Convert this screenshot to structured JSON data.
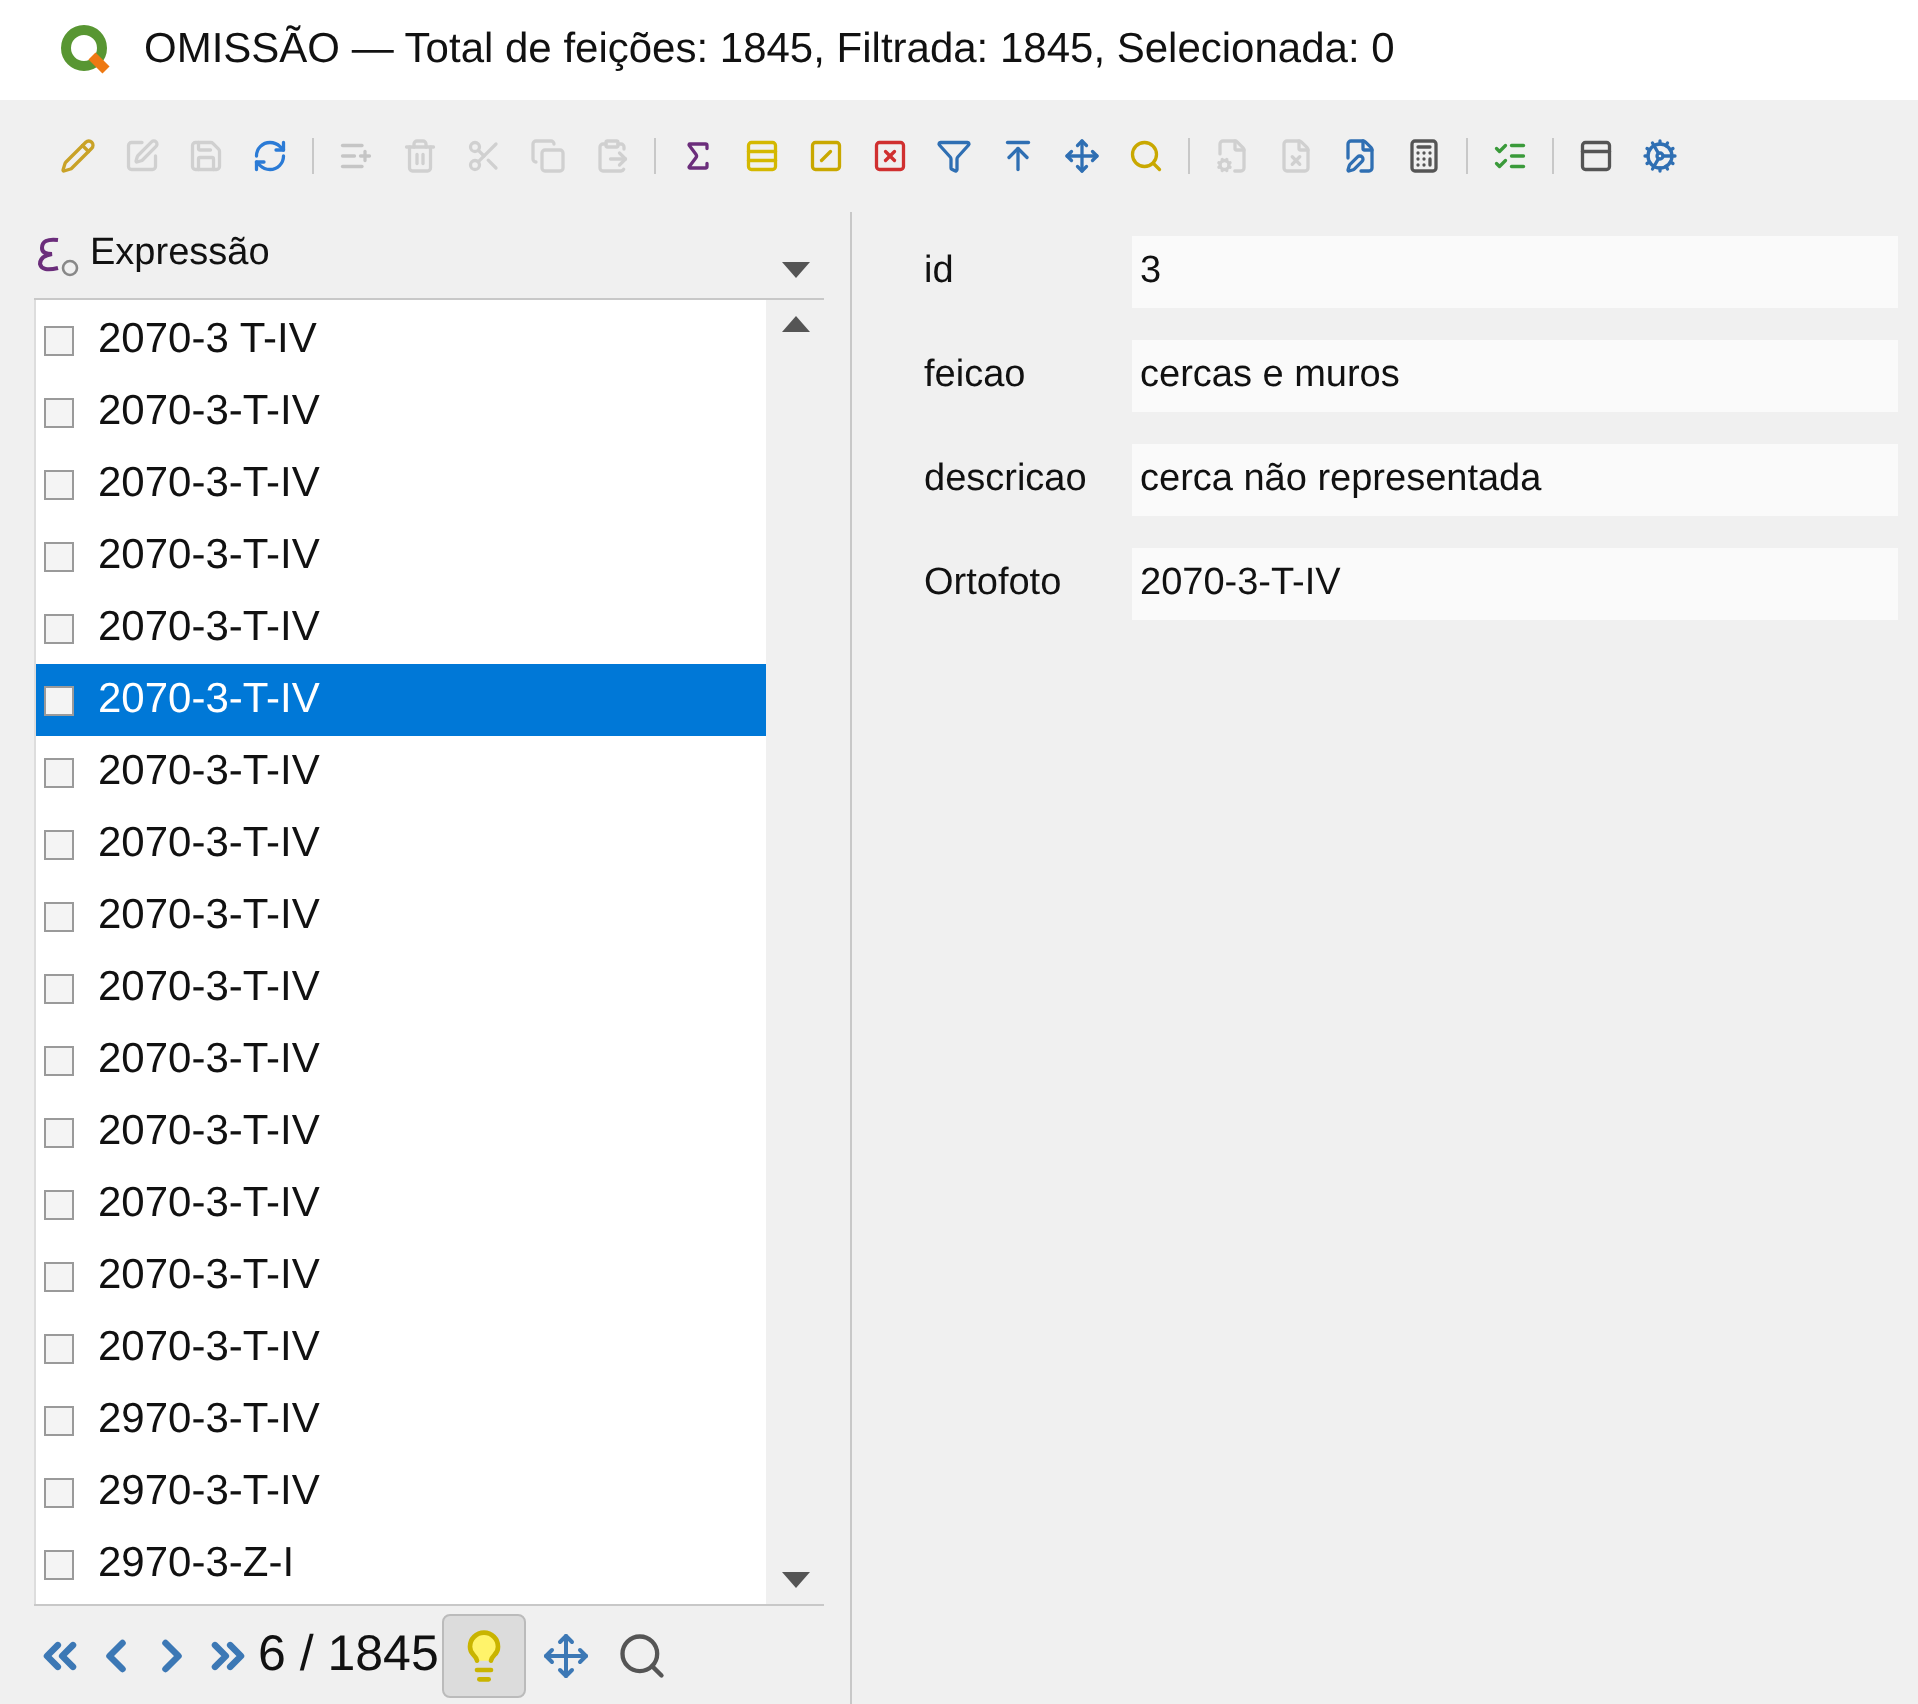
{
  "window": {
    "title": "OMISSÃO — Total de feições: 1845, Filtrada: 1845, Selecionada: 0"
  },
  "toolbar": {
    "groups": [
      [
        {
          "disabled": false
        },
        {
          "disabled": true
        },
        {
          "disabled": true
        },
        {
          "disabled": false
        }
      ],
      [
        {
          "disabled": true
        },
        {
          "disabled": true
        },
        {
          "disabled": true
        },
        {
          "disabled": true
        },
        {
          "disabled": true
        }
      ],
      [
        {
          "disabled": false
        },
        {
          "disabled": false
        },
        {
          "disabled": false
        },
        {
          "disabled": false
        },
        {
          "disabled": false
        },
        {
          "disabled": false
        },
        {
          "disabled": false
        },
        {
          "disabled": false
        }
      ],
      [
        {
          "disabled": true
        },
        {
          "disabled": true
        },
        {
          "disabled": false
        },
        {
          "disabled": false
        }
      ],
      [
        {
          "disabled": false
        }
      ],
      [
        {
          "disabled": false
        },
        {
          "disabled": false
        }
      ]
    ]
  },
  "list": {
    "header": "Expressão",
    "rows": [
      {
        "label": "2070-3 T-IV",
        "checked": false,
        "selected": false
      },
      {
        "label": "2070-3-T-IV",
        "checked": false,
        "selected": false
      },
      {
        "label": "2070-3-T-IV",
        "checked": false,
        "selected": false
      },
      {
        "label": "2070-3-T-IV",
        "checked": false,
        "selected": false
      },
      {
        "label": "2070-3-T-IV",
        "checked": false,
        "selected": false
      },
      {
        "label": "2070-3-T-IV",
        "checked": false,
        "selected": true
      },
      {
        "label": "2070-3-T-IV",
        "checked": false,
        "selected": false
      },
      {
        "label": "2070-3-T-IV",
        "checked": false,
        "selected": false
      },
      {
        "label": "2070-3-T-IV",
        "checked": false,
        "selected": false
      },
      {
        "label": "2070-3-T-IV",
        "checked": false,
        "selected": false
      },
      {
        "label": "2070-3-T-IV",
        "checked": false,
        "selected": false
      },
      {
        "label": "2070-3-T-IV",
        "checked": false,
        "selected": false
      },
      {
        "label": "2070-3-T-IV",
        "checked": false,
        "selected": false
      },
      {
        "label": "2070-3-T-IV",
        "checked": false,
        "selected": false
      },
      {
        "label": "2070-3-T-IV",
        "checked": false,
        "selected": false
      },
      {
        "label": "2970-3-T-IV",
        "checked": false,
        "selected": false
      },
      {
        "label": "2970-3-T-IV",
        "checked": false,
        "selected": false
      },
      {
        "label": "2970-3-Z-I",
        "checked": false,
        "selected": false
      }
    ]
  },
  "navigation": {
    "position": "6 / 1845",
    "highlight_on": true
  },
  "form": {
    "fields": [
      {
        "label": "id",
        "value": "3"
      },
      {
        "label": "feicao",
        "value": "cercas e muros"
      },
      {
        "label": "descricao",
        "value": "cerca não representada"
      },
      {
        "label": "Ortofoto",
        "value": "2070-3-T-IV"
      }
    ]
  }
}
